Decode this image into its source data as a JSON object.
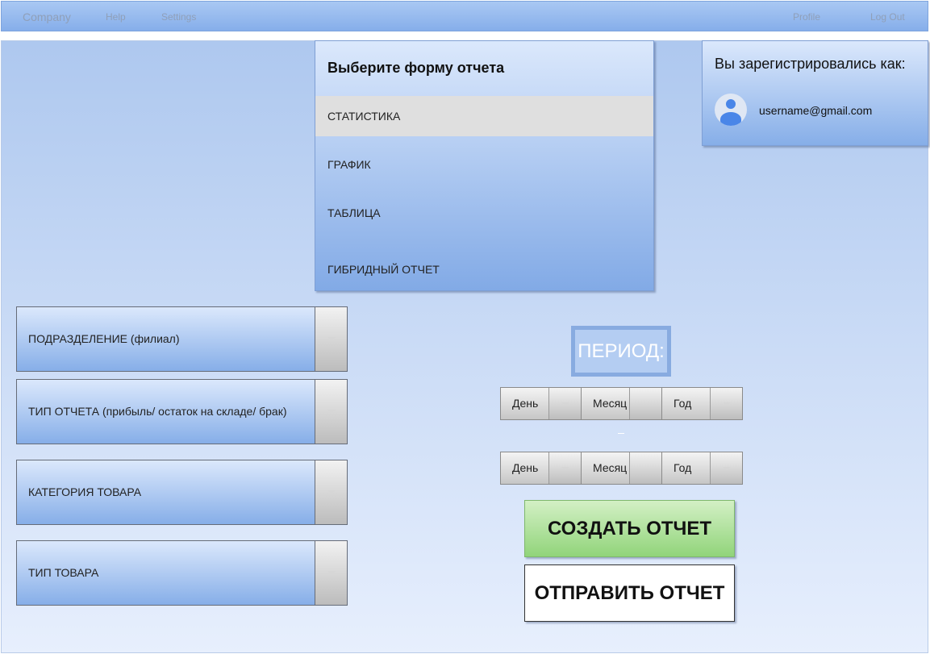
{
  "navbar": {
    "brand": "Company",
    "help": "Help",
    "settings": "Settings",
    "profile": "Profile",
    "logout": "Log Out"
  },
  "report_form": {
    "title": "Выберите форму отчета",
    "items": [
      "СТАТИСТИКА",
      "ГРАФИК",
      "ТАБЛИЦА",
      "ГИБРИДНЫЙ ОТЧЕТ"
    ],
    "selected": "СТАТИСТИКА"
  },
  "user": {
    "caption": "Вы зарегистрировались как:",
    "email": "username@gmail.com",
    "avatar_icon": "user-avatar-icon"
  },
  "filters": [
    {
      "label": "ПОДРАЗДЕЛЕНИЕ (филиал)"
    },
    {
      "label": "ТИП ОТЧЕТА (прибыль/ остаток на складе/ брак)"
    },
    {
      "label": "КАТЕГОРИЯ ТОВАРА"
    },
    {
      "label": "ТИП ТОВАРА"
    }
  ],
  "period": {
    "title": "ПЕРИОД:",
    "from": {
      "day": "День",
      "month": "Месяц",
      "year": "Год"
    },
    "to": {
      "day": "День",
      "month": "Месяц",
      "year": "Год"
    }
  },
  "actions": {
    "create": "СОЗДАТЬ ОТЧЕТ",
    "send": "ОТПРАВИТЬ ОТЧЕТ"
  },
  "colors": {
    "navbar": "#9bbcf0",
    "panel_gradient_top": "#dbe8fc",
    "panel_gradient_bottom": "#82aae6",
    "create_button": "#a6dc8f",
    "selected_item": "#dfdfdf"
  }
}
